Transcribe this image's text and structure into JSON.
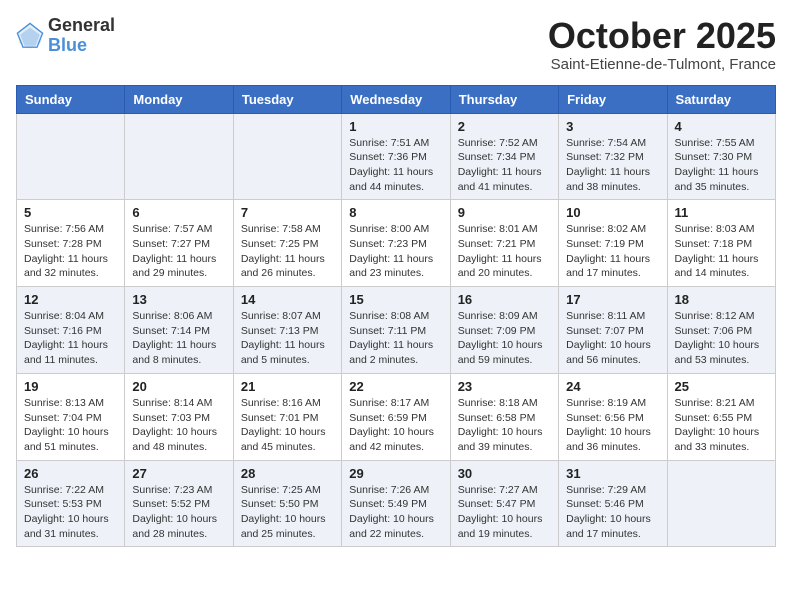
{
  "header": {
    "logo_general": "General",
    "logo_blue": "Blue",
    "month": "October 2025",
    "location": "Saint-Etienne-de-Tulmont, France"
  },
  "days_of_week": [
    "Sunday",
    "Monday",
    "Tuesday",
    "Wednesday",
    "Thursday",
    "Friday",
    "Saturday"
  ],
  "weeks": [
    [
      {
        "date": "",
        "text": ""
      },
      {
        "date": "",
        "text": ""
      },
      {
        "date": "",
        "text": ""
      },
      {
        "date": "1",
        "text": "Sunrise: 7:51 AM\nSunset: 7:36 PM\nDaylight: 11 hours\nand 44 minutes."
      },
      {
        "date": "2",
        "text": "Sunrise: 7:52 AM\nSunset: 7:34 PM\nDaylight: 11 hours\nand 41 minutes."
      },
      {
        "date": "3",
        "text": "Sunrise: 7:54 AM\nSunset: 7:32 PM\nDaylight: 11 hours\nand 38 minutes."
      },
      {
        "date": "4",
        "text": "Sunrise: 7:55 AM\nSunset: 7:30 PM\nDaylight: 11 hours\nand 35 minutes."
      }
    ],
    [
      {
        "date": "5",
        "text": "Sunrise: 7:56 AM\nSunset: 7:28 PM\nDaylight: 11 hours\nand 32 minutes."
      },
      {
        "date": "6",
        "text": "Sunrise: 7:57 AM\nSunset: 7:27 PM\nDaylight: 11 hours\nand 29 minutes."
      },
      {
        "date": "7",
        "text": "Sunrise: 7:58 AM\nSunset: 7:25 PM\nDaylight: 11 hours\nand 26 minutes."
      },
      {
        "date": "8",
        "text": "Sunrise: 8:00 AM\nSunset: 7:23 PM\nDaylight: 11 hours\nand 23 minutes."
      },
      {
        "date": "9",
        "text": "Sunrise: 8:01 AM\nSunset: 7:21 PM\nDaylight: 11 hours\nand 20 minutes."
      },
      {
        "date": "10",
        "text": "Sunrise: 8:02 AM\nSunset: 7:19 PM\nDaylight: 11 hours\nand 17 minutes."
      },
      {
        "date": "11",
        "text": "Sunrise: 8:03 AM\nSunset: 7:18 PM\nDaylight: 11 hours\nand 14 minutes."
      }
    ],
    [
      {
        "date": "12",
        "text": "Sunrise: 8:04 AM\nSunset: 7:16 PM\nDaylight: 11 hours\nand 11 minutes."
      },
      {
        "date": "13",
        "text": "Sunrise: 8:06 AM\nSunset: 7:14 PM\nDaylight: 11 hours\nand 8 minutes."
      },
      {
        "date": "14",
        "text": "Sunrise: 8:07 AM\nSunset: 7:13 PM\nDaylight: 11 hours\nand 5 minutes."
      },
      {
        "date": "15",
        "text": "Sunrise: 8:08 AM\nSunset: 7:11 PM\nDaylight: 11 hours\nand 2 minutes."
      },
      {
        "date": "16",
        "text": "Sunrise: 8:09 AM\nSunset: 7:09 PM\nDaylight: 10 hours\nand 59 minutes."
      },
      {
        "date": "17",
        "text": "Sunrise: 8:11 AM\nSunset: 7:07 PM\nDaylight: 10 hours\nand 56 minutes."
      },
      {
        "date": "18",
        "text": "Sunrise: 8:12 AM\nSunset: 7:06 PM\nDaylight: 10 hours\nand 53 minutes."
      }
    ],
    [
      {
        "date": "19",
        "text": "Sunrise: 8:13 AM\nSunset: 7:04 PM\nDaylight: 10 hours\nand 51 minutes."
      },
      {
        "date": "20",
        "text": "Sunrise: 8:14 AM\nSunset: 7:03 PM\nDaylight: 10 hours\nand 48 minutes."
      },
      {
        "date": "21",
        "text": "Sunrise: 8:16 AM\nSunset: 7:01 PM\nDaylight: 10 hours\nand 45 minutes."
      },
      {
        "date": "22",
        "text": "Sunrise: 8:17 AM\nSunset: 6:59 PM\nDaylight: 10 hours\nand 42 minutes."
      },
      {
        "date": "23",
        "text": "Sunrise: 8:18 AM\nSunset: 6:58 PM\nDaylight: 10 hours\nand 39 minutes."
      },
      {
        "date": "24",
        "text": "Sunrise: 8:19 AM\nSunset: 6:56 PM\nDaylight: 10 hours\nand 36 minutes."
      },
      {
        "date": "25",
        "text": "Sunrise: 8:21 AM\nSunset: 6:55 PM\nDaylight: 10 hours\nand 33 minutes."
      }
    ],
    [
      {
        "date": "26",
        "text": "Sunrise: 7:22 AM\nSunset: 5:53 PM\nDaylight: 10 hours\nand 31 minutes."
      },
      {
        "date": "27",
        "text": "Sunrise: 7:23 AM\nSunset: 5:52 PM\nDaylight: 10 hours\nand 28 minutes."
      },
      {
        "date": "28",
        "text": "Sunrise: 7:25 AM\nSunset: 5:50 PM\nDaylight: 10 hours\nand 25 minutes."
      },
      {
        "date": "29",
        "text": "Sunrise: 7:26 AM\nSunset: 5:49 PM\nDaylight: 10 hours\nand 22 minutes."
      },
      {
        "date": "30",
        "text": "Sunrise: 7:27 AM\nSunset: 5:47 PM\nDaylight: 10 hours\nand 19 minutes."
      },
      {
        "date": "31",
        "text": "Sunrise: 7:29 AM\nSunset: 5:46 PM\nDaylight: 10 hours\nand 17 minutes."
      },
      {
        "date": "",
        "text": ""
      }
    ]
  ],
  "shaded_rows": [
    0,
    2,
    4
  ]
}
